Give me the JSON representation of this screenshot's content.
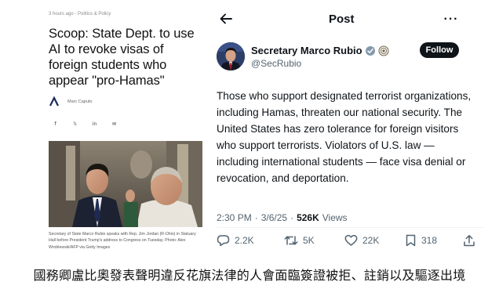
{
  "article": {
    "meta": "3 hours ago - Politics & Policy",
    "headline": "Scoop: State Dept. to use AI to revoke visas of foreign students who appear \"pro-Hamas\"",
    "author": "Marc Caputo",
    "share_icons": [
      "facebook-icon",
      "x-icon",
      "linkedin-icon",
      "email-icon"
    ],
    "share_glyphs": [
      "f",
      "𝕏",
      "in",
      "✉"
    ],
    "caption": "Secretary of State Marco Rubio speaks with Rep. Jim Jordan (R-Ohio) in Statuary Hall before President Trump's address to Congress on Tuesday. Photo: Alex Wroblewski/AFP via Getty Images"
  },
  "post": {
    "header_title": "Post",
    "more_label": "···",
    "display_name": "Secretary Marco Rubio",
    "handle": "@SecRubio",
    "follow_label": "Follow",
    "body": "Those who support designated terrorist organizations, including Hamas, threaten our national security. The United States has zero tolerance for foreign visitors who support terrorists. Violators of U.S. law — including international students — face visa denial or revocation, and deportation.",
    "time": "2:30 PM",
    "date": "3/6/25",
    "separator": "·",
    "views_count": "526K",
    "views_label": "Views",
    "replies": "2.2K",
    "reposts": "5K",
    "likes": "22K",
    "bookmarks": "318"
  },
  "bottom_caption": "國務卿盧比奧發表聲明違反花旗法律的人會面臨簽證被拒、註銷以及驅逐出境",
  "colors": {
    "text_primary": "#0f1419",
    "text_secondary": "#536471",
    "follow_bg": "#0f1419",
    "verified_blue": "#1d9bf0"
  }
}
